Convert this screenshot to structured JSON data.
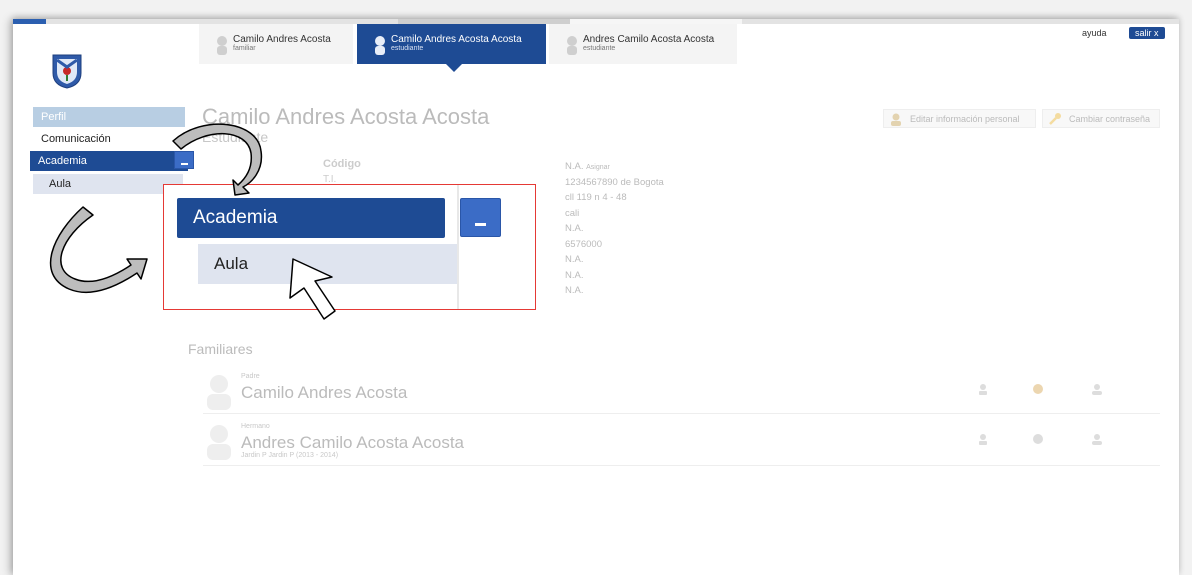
{
  "header": {
    "tabs": [
      {
        "name": "Camilo Andres Acosta",
        "role": "familiar"
      },
      {
        "name": "Camilo Andres Acosta Acosta",
        "role": "estudiante"
      },
      {
        "name": "Andres Camilo Acosta Acosta",
        "role": "estudiante"
      }
    ],
    "ayuda": "ayuda",
    "salir": "salir x"
  },
  "sidebar": {
    "items": [
      {
        "label": "Perfil"
      },
      {
        "label": "Comunicación"
      },
      {
        "label": "Academia"
      },
      {
        "label": "Aula"
      }
    ]
  },
  "profile": {
    "name": "Camilo Andres Acosta Acosta",
    "role": "Estudiante",
    "edit_label": "Editar información personal",
    "password_label": "Cambiar contraseña",
    "code_label": "Código",
    "id_label": "T.I.",
    "values": [
      "N.A.",
      "1234567890 de Bogota",
      "cll 119 n 4 - 48",
      "cali",
      "N.A.",
      "6576000",
      "N.A.",
      "N.A.",
      "N.A."
    ],
    "assign_label": "Asignar"
  },
  "familiares": {
    "title": "Familiares",
    "rows": [
      {
        "relation": "Padre",
        "name": "Camilo Andres Acosta",
        "sub": ""
      },
      {
        "relation": "Hermano",
        "name": "Andres Camilo Acosta Acosta",
        "sub": "Jardin P Jardin P (2013 - 2014)"
      }
    ]
  },
  "zoom": {
    "academia": "Academia",
    "aula": "Aula"
  },
  "colors": {
    "primary": "#1e4b94",
    "button": "#3b6cc6",
    "highlight_border": "#e53935"
  }
}
